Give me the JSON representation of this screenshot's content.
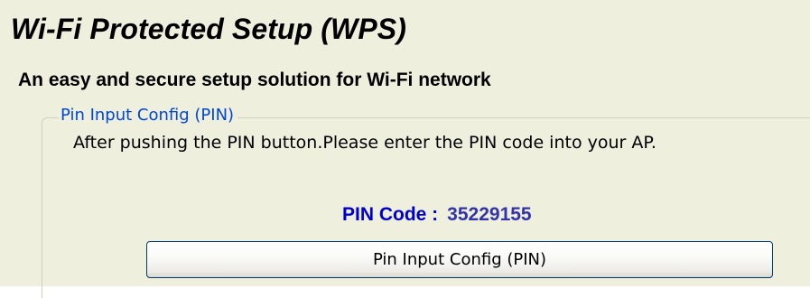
{
  "header": {
    "title": "Wi-Fi Protected Setup (WPS)",
    "subtitle": "An easy and secure setup solution for Wi-Fi network"
  },
  "pin_section": {
    "legend": "Pin Input Config (PIN)",
    "instruction": "After pushing the PIN button.Please enter the PIN code into your AP.",
    "pin_label": "PIN Code :",
    "pin_value": "35229155",
    "button_label": "Pin Input Config (PIN)"
  },
  "colors": {
    "panel_background": "#efefde",
    "legend_text": "#0046d5",
    "pin_label": "#0000cc",
    "button_border": "#003c74"
  }
}
